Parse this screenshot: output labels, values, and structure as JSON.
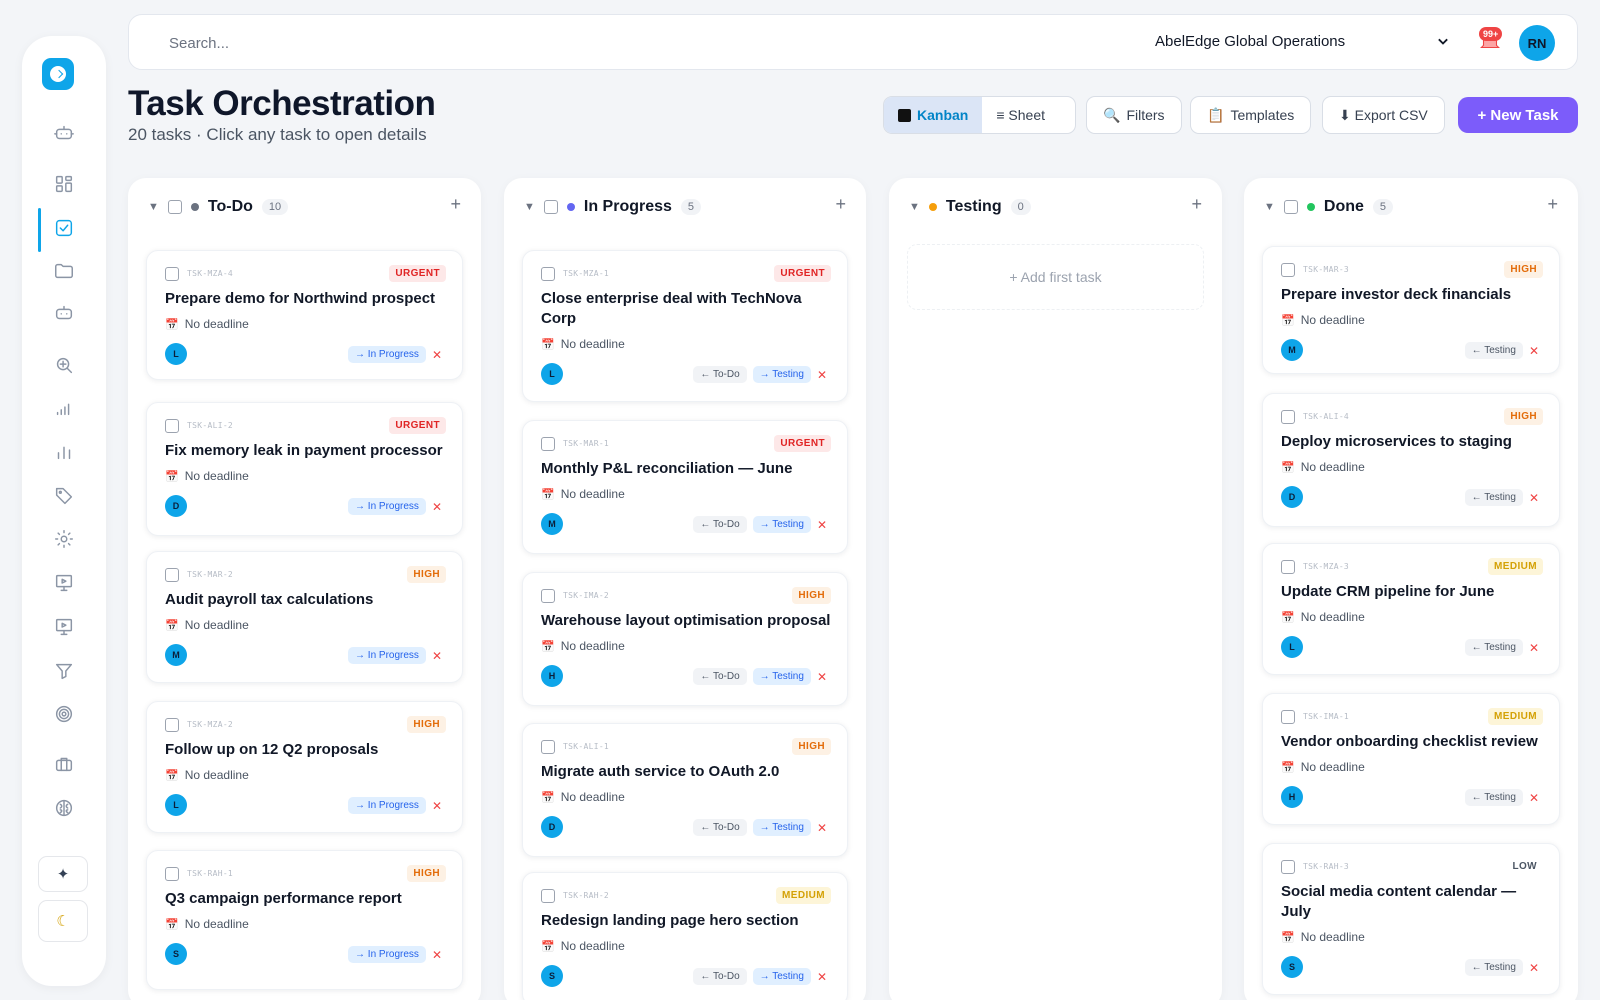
{
  "topbar": {
    "search_placeholder": "Search...",
    "org": "AbelEdge Global Operations",
    "notifications": "99+",
    "user_initials": "RN"
  },
  "header": {
    "title": "Task Orchestration",
    "subtitle": "20 tasks · Click any task to open details"
  },
  "toolbar": {
    "kanban": "Kanban",
    "sheet": "≡ Sheet",
    "filters": "Filters",
    "templates": "Templates",
    "export": "⬇ Export CSV",
    "new_task": "+ New Task"
  },
  "columns": [
    {
      "title": "To-Do",
      "count": "10",
      "dot": "#6b7280",
      "add_first": ""
    },
    {
      "title": "In Progress",
      "count": "5",
      "dot": "#6366f1",
      "add_first": ""
    },
    {
      "title": "Testing",
      "count": "0",
      "dot": "#f59e0b",
      "add_first": "+ Add first task"
    },
    {
      "title": "Done",
      "count": "5",
      "dot": "#22c55e",
      "add_first": ""
    }
  ],
  "labels": {
    "no_deadline": "No deadline",
    "urgent": "URGENT",
    "high": "HIGH",
    "medium": "MEDIUM",
    "low": "LOW",
    "to_in_progress": "→ In Progress",
    "to_todo": "← To-Do",
    "to_testing": "→ Testing",
    "back_testing": "← Testing",
    "remove": "✕"
  },
  "todo": [
    {
      "id": "TSK-MZA-4",
      "title": "Prepare demo for Northwind prospect",
      "avatar": "L"
    },
    {
      "id": "TSK-ALI-2",
      "title": "Fix memory leak in payment processor",
      "avatar": "D"
    },
    {
      "id": "TSK-MAR-2",
      "title": "Audit payroll tax calculations",
      "avatar": "M"
    },
    {
      "id": "TSK-MZA-2",
      "title": "Follow up on 12 Q2 proposals",
      "avatar": "L"
    },
    {
      "id": "TSK-RAH-1",
      "title": "Q3 campaign performance report",
      "avatar": "S"
    }
  ],
  "in_progress": [
    {
      "id": "TSK-MZA-1",
      "title": "Close enterprise deal with TechNova Corp",
      "avatar": "L"
    },
    {
      "id": "TSK-MAR-1",
      "title": "Monthly P&L reconciliation — June",
      "avatar": "M"
    },
    {
      "id": "TSK-IMA-2",
      "title": "Warehouse layout optimisation proposal",
      "avatar": "H"
    },
    {
      "id": "TSK-ALI-1",
      "title": "Migrate auth service to OAuth 2.0",
      "avatar": "D"
    },
    {
      "id": "TSK-RAH-2",
      "title": "Redesign landing page hero section",
      "avatar": "S"
    }
  ],
  "done": [
    {
      "id": "TSK-MAR-3",
      "title": "Prepare investor deck financials",
      "avatar": "M"
    },
    {
      "id": "TSK-ALI-4",
      "title": "Deploy microservices to staging",
      "avatar": "D"
    },
    {
      "id": "TSK-MZA-3",
      "title": "Update CRM pipeline for June",
      "avatar": "L"
    },
    {
      "id": "TSK-IMA-1",
      "title": "Vendor onboarding checklist review",
      "avatar": "H"
    },
    {
      "id": "TSK-RAH-3",
      "title": "Social media content calendar — July",
      "avatar": "S"
    }
  ]
}
